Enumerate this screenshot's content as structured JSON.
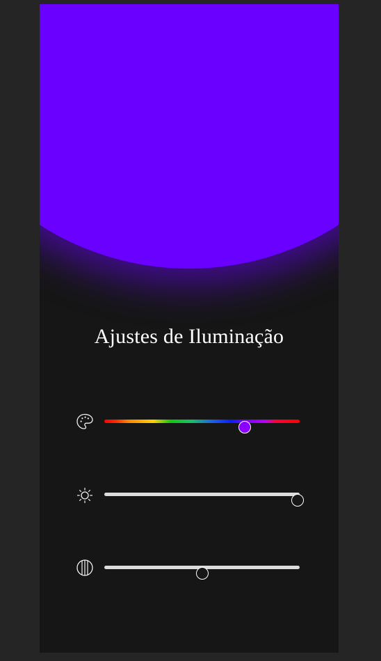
{
  "panel": {
    "title": "Ajustes de Iluminação",
    "light_color": "#6a00ff"
  },
  "controls": [
    {
      "id": "hue",
      "icon": "palette-icon",
      "value_fraction": 0.72,
      "thumb_color": "#8b00ff"
    },
    {
      "id": "brightness",
      "icon": "sun-icon",
      "value_fraction": 0.99
    },
    {
      "id": "contrast",
      "icon": "contrast-icon",
      "value_fraction": 0.5
    }
  ]
}
